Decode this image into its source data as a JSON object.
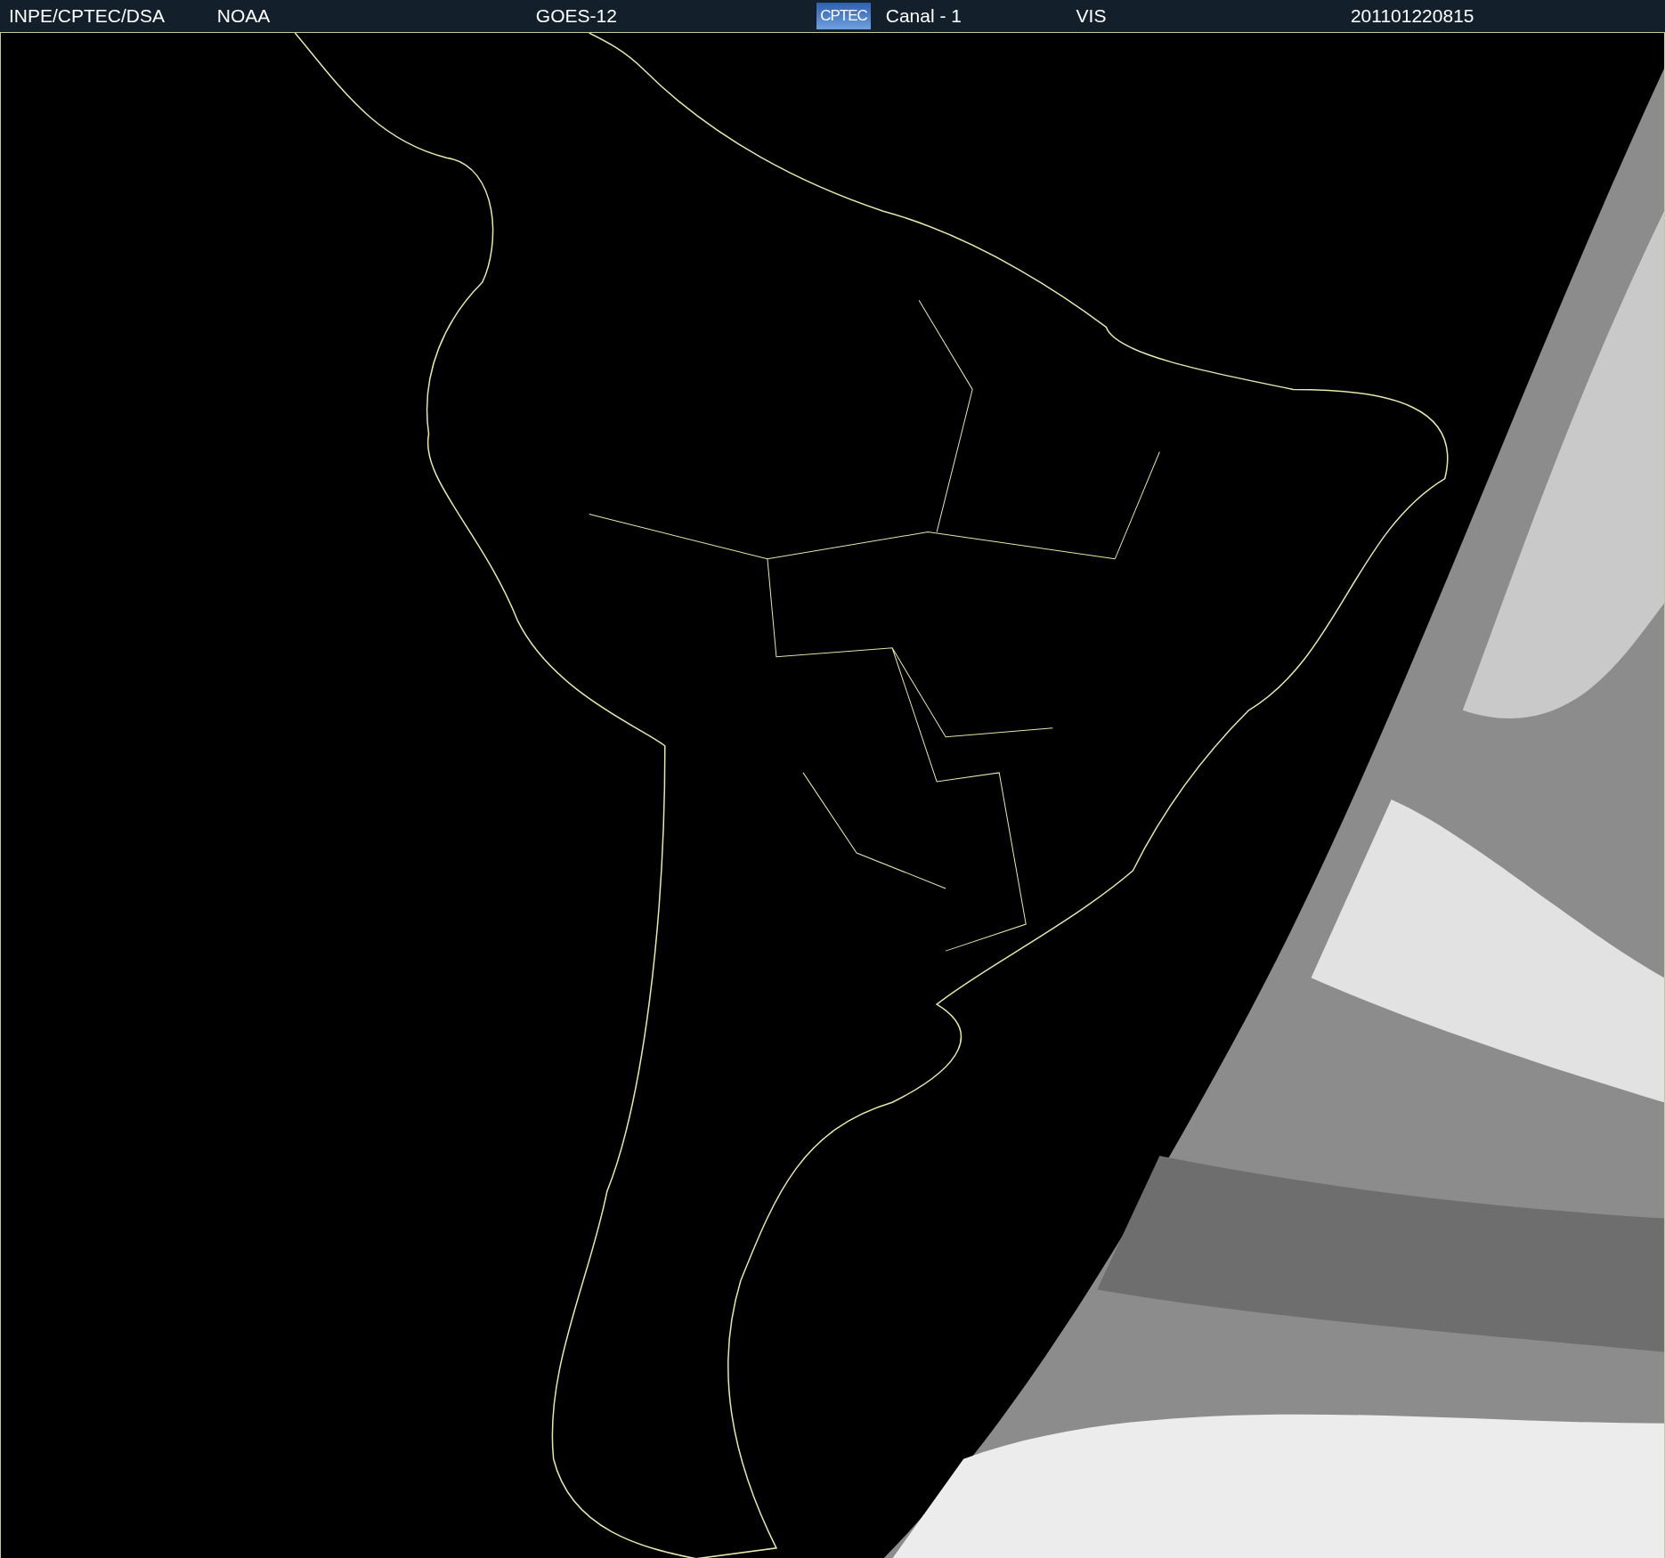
{
  "header": {
    "items": [
      {
        "kind": "text",
        "text": "INPE/CPTEC/DSA"
      },
      {
        "kind": "text",
        "text": "NOAA"
      },
      {
        "kind": "text",
        "text": "GOES-12"
      },
      {
        "kind": "logo",
        "text": "CPTEC"
      },
      {
        "kind": "text",
        "text": "Canal - 1"
      },
      {
        "kind": "text",
        "text": "VIS"
      },
      {
        "kind": "text",
        "text": "201101220815"
      }
    ]
  }
}
